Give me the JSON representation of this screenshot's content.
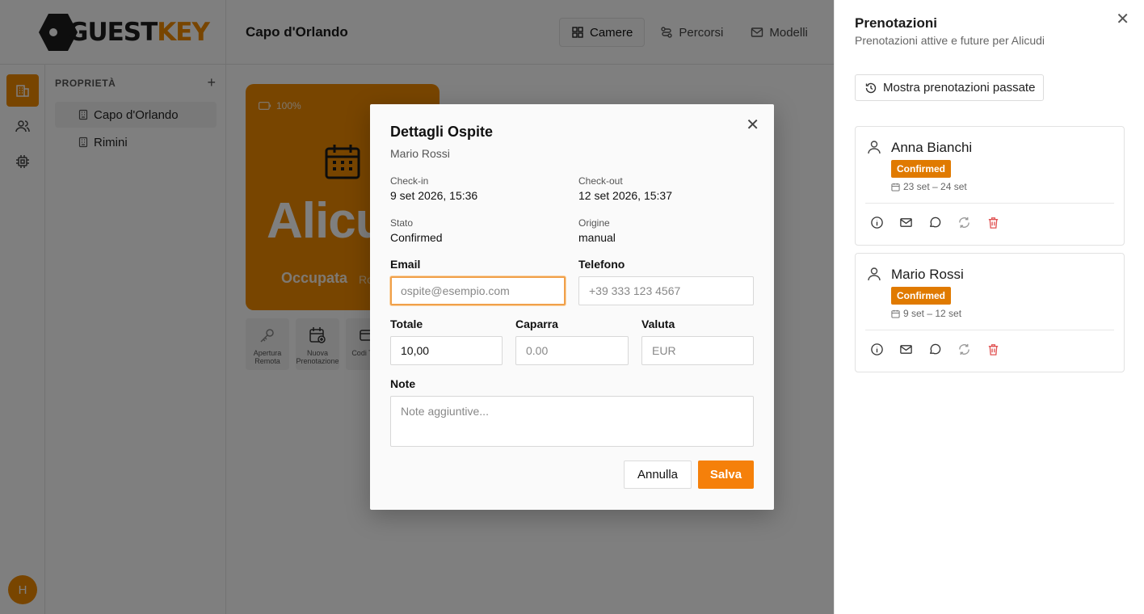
{
  "app": {
    "logo": {
      "part1": "GUEST",
      "part2": "KEY"
    },
    "page_title": "Capo d'Orlando",
    "nav": [
      {
        "label": "Camere",
        "icon": "grid-icon"
      },
      {
        "label": "Percorsi",
        "icon": "route-icon"
      },
      {
        "label": "Modelli",
        "icon": "mail-icon"
      }
    ],
    "avatar_initial": "H"
  },
  "properties": {
    "header": "PROPRIETÀ",
    "add_icon": "plus-icon",
    "items": [
      {
        "label": "Capo d'Orlando"
      },
      {
        "label": "Rimini"
      }
    ]
  },
  "room_card": {
    "battery": "100%",
    "name": "Alicudi",
    "status": "Occupata",
    "extra": "Ro"
  },
  "room_actions": [
    {
      "label": "Apertura Remota",
      "icon": "key-icon"
    },
    {
      "label": "Nuova Prenotazione",
      "icon": "calendar-plus-icon"
    },
    {
      "label": "Codi Tess",
      "icon": "card-icon"
    }
  ],
  "sheet": {
    "title": "Prenotazioni",
    "subtitle": "Prenotazioni attive e future per Alicudi",
    "past_button": "Mostra prenotazioni passate",
    "bookings": [
      {
        "guest": "Anna Bianchi",
        "status": "Confirmed",
        "dates": "23 set – 24 set"
      },
      {
        "guest": "Mario Rossi",
        "status": "Confirmed",
        "dates": "9 set – 12 set"
      }
    ],
    "colors": {
      "badge": "#e07a00",
      "delete": "#e05252"
    }
  },
  "modal": {
    "title": "Dettagli Ospite",
    "subtitle": "Mario Rossi",
    "checkin_label": "Check-in",
    "checkin_value": "9 set 2026, 15:36",
    "checkout_label": "Check-out",
    "checkout_value": "12 set 2026, 15:37",
    "status_label": "Stato",
    "status_value": "Confirmed",
    "origin_label": "Origine",
    "origin_value": "manual",
    "email_label": "Email",
    "email_placeholder": "ospite@esempio.com",
    "phone_label": "Telefono",
    "phone_placeholder": "+39 333 123 4567",
    "total_label": "Totale",
    "total_value": "10,00",
    "deposit_label": "Caparra",
    "deposit_placeholder": "0.00",
    "currency_label": "Valuta",
    "currency_placeholder": "EUR",
    "notes_label": "Note",
    "notes_placeholder": "Note aggiuntive...",
    "cancel_label": "Annulla",
    "save_label": "Salva",
    "colors": {
      "accent": "#f5800a"
    }
  }
}
